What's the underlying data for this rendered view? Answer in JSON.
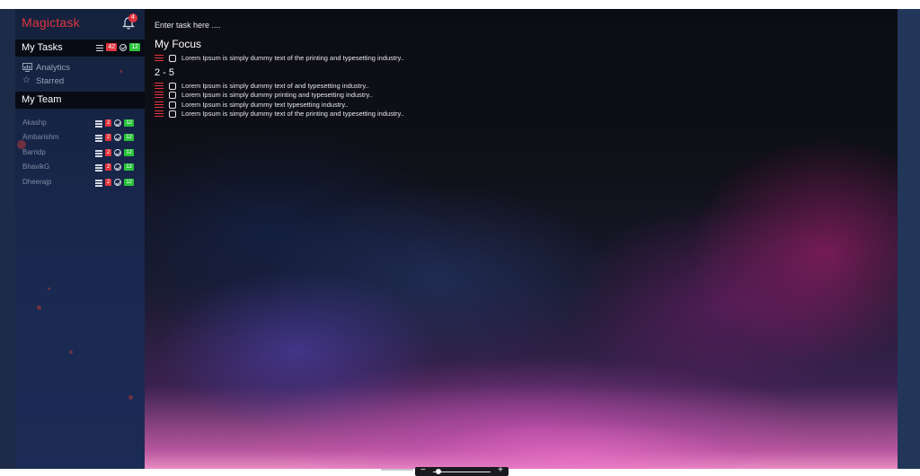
{
  "app": {
    "brand": "Magictask",
    "notifications_count": "4"
  },
  "sidebar": {
    "my_tasks": {
      "label": "My Tasks",
      "open_count": "42",
      "done_count": "12"
    },
    "nav": [
      {
        "label": "Analytics",
        "icon": "analytics-icon"
      },
      {
        "label": "Starred",
        "icon": "star-icon"
      }
    ],
    "my_team": {
      "label": "My Team",
      "members": [
        {
          "name": "Akashp",
          "open_count": "2",
          "done_count": "12"
        },
        {
          "name": "Ambarishm",
          "open_count": "2",
          "done_count": "12"
        },
        {
          "name": "Barridp",
          "open_count": "2",
          "done_count": "12"
        },
        {
          "name": "BhavikG",
          "open_count": "2",
          "done_count": "12"
        },
        {
          "name": "Dheerajp",
          "open_count": "2",
          "done_count": "12"
        }
      ]
    }
  },
  "main": {
    "task_input": {
      "placeholder": "Enter task here ...."
    },
    "focus": {
      "title": "My Focus",
      "tasks": [
        "Lorem Ipsum is simply dummy text of the printing and typesetting industry.."
      ]
    },
    "range_group": {
      "title": "2 - 5",
      "tasks": [
        "Lorem Ipsum is simply dummy text of and typesetting industry..",
        "Lorem Ipsum is simply dummy  printing and typesetting industry..",
        "Lorem Ipsum is simply dummy text typesetting industry..",
        "Lorem Ipsum is simply dummy text of the printing and typesetting industry.."
      ]
    }
  },
  "zoom": {
    "minus": "−",
    "plus": "+",
    "level": 0.1
  },
  "colors": {
    "brand": "#e0343e",
    "badge_red": "#e0343e",
    "badge_green": "#29c23a",
    "sidebar_bg": "#17264a"
  }
}
